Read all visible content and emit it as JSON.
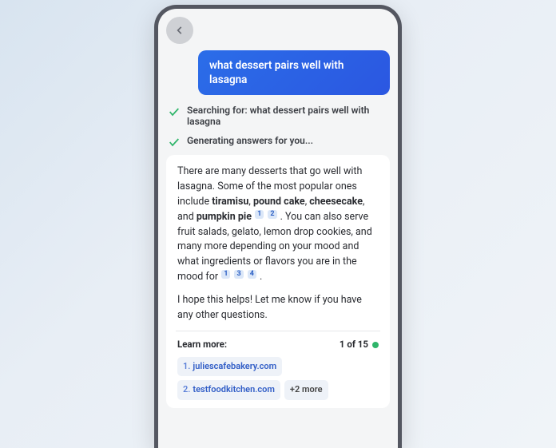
{
  "user_message": "what dessert pairs well with lasagna",
  "status": {
    "searching_prefix": "Searching for: ",
    "searching_query": "what dessert pairs well with lasagna",
    "generating": "Generating answers for you..."
  },
  "answer": {
    "p1_a": "There are many desserts that go well with lasagna. Some of the most popular ones include ",
    "p1_b1": "tiramisu",
    "p1_sep1": ", ",
    "p1_b2": "pound cake",
    "p1_sep2": ", ",
    "p1_b3": "cheesecake",
    "p1_sep3": ", and ",
    "p1_b4": "pumpkin pie",
    "p1_cit1": "1",
    "p1_cit2": "2",
    "p1_c": " . You can also serve fruit salads, gelato, lemon drop cookies, and many more depending on your mood and what ingredients or flavors you are in the mood for ",
    "p1_cit3": "1",
    "p1_cit4": "3",
    "p1_cit5": "4",
    "p1_end": " .",
    "p2": "I hope this helps! Let me know if you have any other questions."
  },
  "learn_more": {
    "label": "Learn more:",
    "count": "1 of 15",
    "sources": [
      {
        "num": "1.",
        "domain": "juliescafebakery.com"
      },
      {
        "num": "2.",
        "domain": "testfoodkitchen.com"
      }
    ],
    "more": "+2 more"
  }
}
